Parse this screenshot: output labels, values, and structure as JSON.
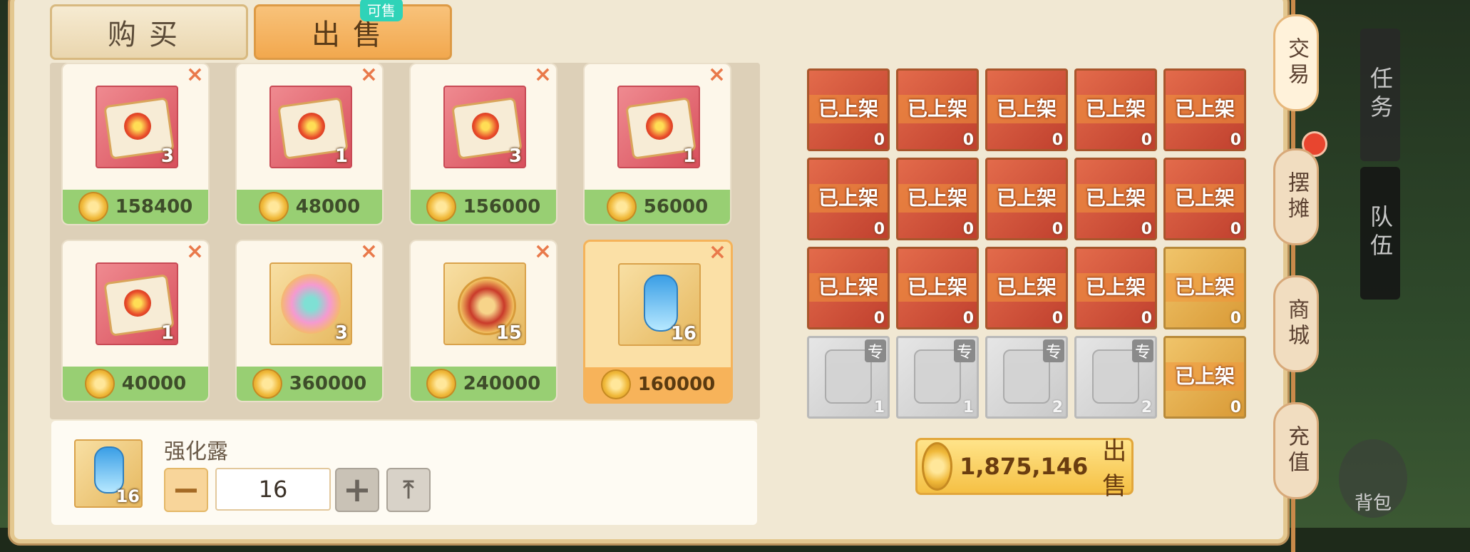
{
  "tabs": {
    "buy_label": "购买",
    "sell_label": "出售",
    "sell_badge": "可售"
  },
  "listings": [
    {
      "count": "3",
      "price": "158400",
      "kind": "red"
    },
    {
      "count": "1",
      "price": "48000",
      "kind": "red"
    },
    {
      "count": "3",
      "price": "156000",
      "kind": "red"
    },
    {
      "count": "1",
      "price": "56000",
      "kind": "red"
    },
    {
      "count": "1",
      "price": "40000",
      "kind": "red"
    },
    {
      "count": "3",
      "price": "360000",
      "kind": "lotus"
    },
    {
      "count": "15",
      "price": "240000",
      "kind": "coinitem"
    },
    {
      "count": "16",
      "price": "160000",
      "kind": "bottle"
    }
  ],
  "close_glyph": "×",
  "selected_item": {
    "name": "强化露",
    "count": "16",
    "quantity": "16",
    "minus": "−",
    "plus": "+",
    "max": "⤒"
  },
  "inventory": {
    "listed_tag": "已上架",
    "exclusive_tag": "专",
    "rows": [
      [
        {
          "n": "0",
          "t": "listed"
        },
        {
          "n": "0",
          "t": "listed"
        },
        {
          "n": "0",
          "t": "listed"
        },
        {
          "n": "0",
          "t": "listed"
        },
        {
          "n": "0",
          "t": "listed"
        }
      ],
      [
        {
          "n": "0",
          "t": "listed"
        },
        {
          "n": "0",
          "t": "listed"
        },
        {
          "n": "0",
          "t": "listed"
        },
        {
          "n": "0",
          "t": "listed"
        },
        {
          "n": "0",
          "t": "listed"
        }
      ],
      [
        {
          "n": "0",
          "t": "listed"
        },
        {
          "n": "0",
          "t": "listed"
        },
        {
          "n": "0",
          "t": "listed"
        },
        {
          "n": "0",
          "t": "listed"
        },
        {
          "n": "0",
          "t": "listed-gold"
        }
      ],
      [
        {
          "n": "1",
          "t": "exclusive"
        },
        {
          "n": "1",
          "t": "exclusive"
        },
        {
          "n": "2",
          "t": "exclusive"
        },
        {
          "n": "2",
          "t": "exclusive"
        },
        {
          "n": "0",
          "t": "listed-gold"
        }
      ]
    ]
  },
  "sell_total": {
    "amount": "1,875,146",
    "label": "出售"
  },
  "side_tabs": [
    "交易",
    "摆摊",
    "商城",
    "充值"
  ],
  "hud": {
    "task": "任务",
    "team": "队伍",
    "bag": "背包"
  },
  "colors": {
    "panel_bg": "#f1e8d3",
    "accent_orange": "#f2a84e",
    "price_green": "#98cf73",
    "listed_red": "#c0402e"
  }
}
